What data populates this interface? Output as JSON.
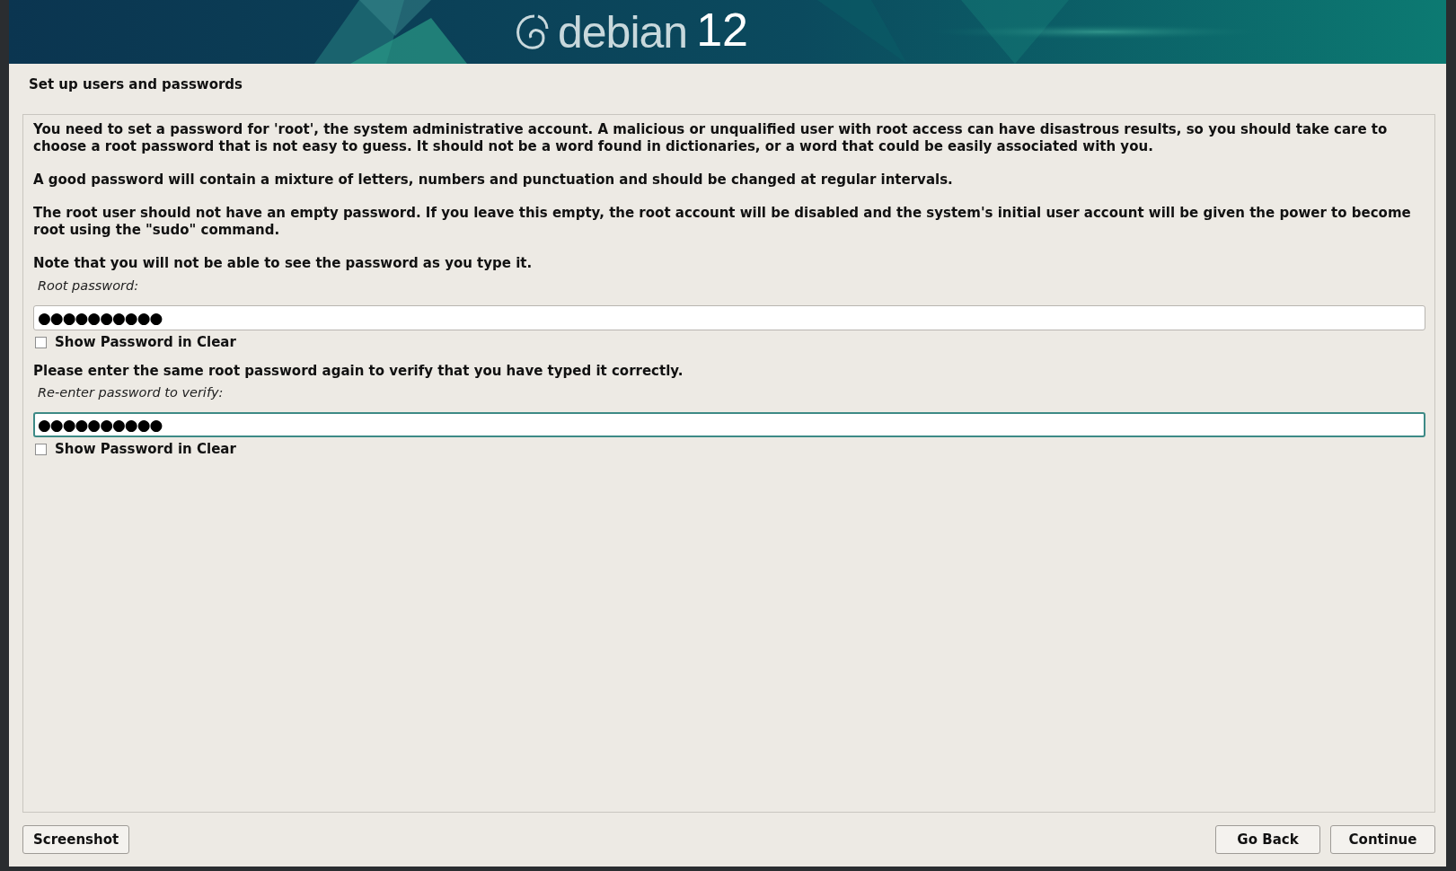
{
  "banner": {
    "wordmark": "debian",
    "version": "12"
  },
  "page_title": "Set up users and passwords",
  "paragraphs": [
    "You need to set a password for 'root', the system administrative account. A malicious or unqualified user with root access can have disastrous results, so you should take care to choose a root password that is not easy to guess. It should not be a word found in dictionaries, or a word that could be easily associated with you.",
    "A good password will contain a mixture of letters, numbers and punctuation and should be changed at regular intervals.",
    "The root user should not have an empty password. If you leave this empty, the root account will be disabled and the system's initial user account will be given the power to become root using the \"sudo\" command.",
    "Note that you will not be able to see the password as you type it."
  ],
  "password_fields": [
    {
      "label": "Root password:",
      "value": "●●●●●●●●●●",
      "focused": false,
      "show_in_clear": {
        "label": "Show Password in Clear",
        "checked": false
      }
    },
    {
      "intro": "Please enter the same root password again to verify that you have typed it correctly.",
      "label": "Re-enter password to verify:",
      "value": "●●●●●●●●●●",
      "focused": true,
      "show_in_clear": {
        "label": "Show Password in Clear",
        "checked": false
      }
    }
  ],
  "left_buttons": [
    "Screenshot"
  ],
  "right_buttons": [
    "Go Back",
    "Continue"
  ]
}
